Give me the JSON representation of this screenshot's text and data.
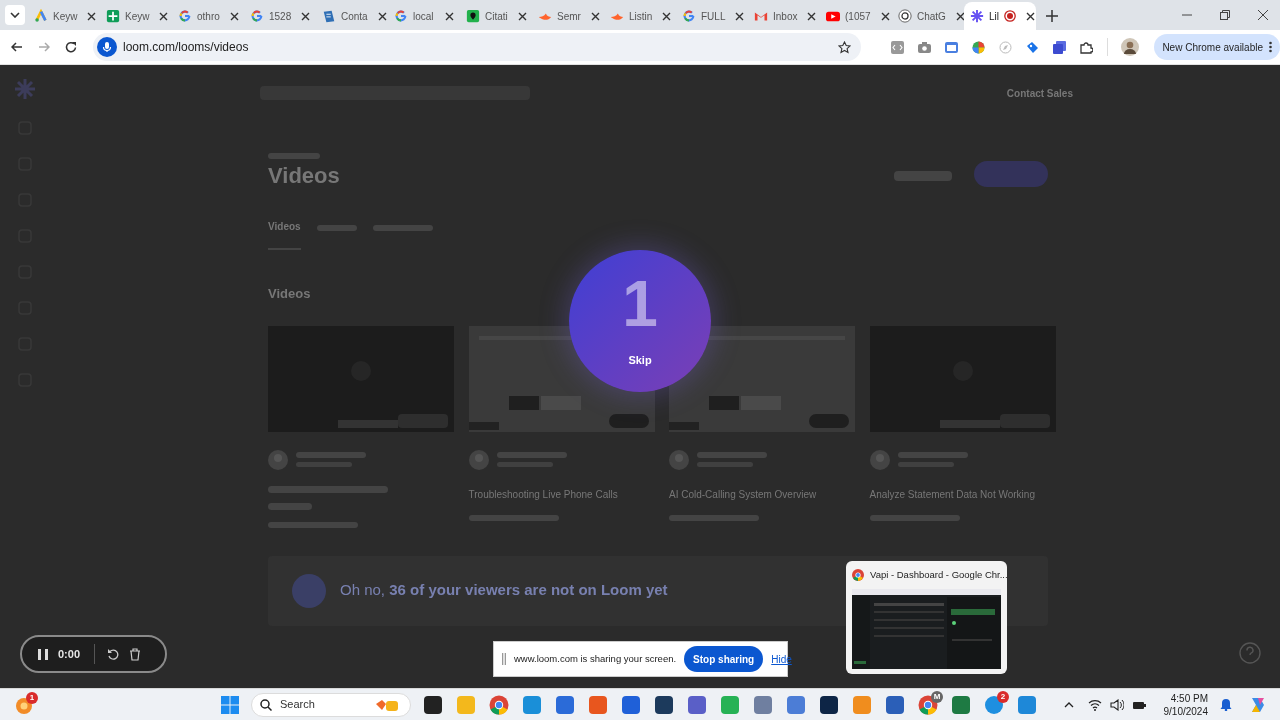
{
  "browser": {
    "tabs": [
      {
        "title": "Keyw",
        "kind": "ads",
        "selected": false
      },
      {
        "title": "Keyw",
        "kind": "sheets",
        "selected": false
      },
      {
        "title": "othro",
        "kind": "google",
        "selected": false
      },
      {
        "title": "1528",
        "kind": "google",
        "selected": false
      },
      {
        "title": "Conta",
        "kind": "doc",
        "selected": false
      },
      {
        "title": "local",
        "kind": "google",
        "selected": false
      },
      {
        "title": "Citati",
        "kind": "citation",
        "selected": false
      },
      {
        "title": "Semr",
        "kind": "semrush",
        "selected": false
      },
      {
        "title": "Listin",
        "kind": "semrush",
        "selected": false
      },
      {
        "title": "FULL",
        "kind": "google",
        "selected": false
      },
      {
        "title": "Inbox",
        "kind": "gmail",
        "selected": false
      },
      {
        "title": "(1057",
        "kind": "youtube",
        "selected": false
      },
      {
        "title": "ChatG",
        "kind": "chatgpt",
        "selected": false
      },
      {
        "title": "Lil",
        "kind": "loom",
        "selected": true,
        "recording": true
      }
    ],
    "url": "loom.com/looms/videos",
    "update_button": "New Chrome available"
  },
  "page": {
    "contact_sales": "Contact Sales",
    "heading": "Videos",
    "tab": "Videos",
    "section": "Videos",
    "cards": [
      {
        "kind": "dark"
      },
      {
        "kind": "screen",
        "title": "Troubleshooting Live Phone Calls"
      },
      {
        "kind": "screen",
        "title": "AI Cold-Calling System Overview"
      },
      {
        "kind": "dark",
        "title": "Analyze Statement Data Not Working"
      }
    ],
    "banner": "Oh no, **36 of your viewers are not on Loom yet**"
  },
  "countdown": {
    "number": "1",
    "skip": "Skip"
  },
  "recorder": {
    "time": "0:00"
  },
  "share_bar": {
    "message": "www.loom.com is sharing your screen.",
    "stop": "Stop sharing",
    "hide": "Hide"
  },
  "preview": {
    "title": "Vapi - Dashboard - Google Chr..."
  },
  "taskbar": {
    "widget_badge": "1",
    "search": "Search",
    "chrome_badge": "M",
    "skype_badge": "2",
    "time": "4:50 PM",
    "date": "9/10/2024"
  }
}
